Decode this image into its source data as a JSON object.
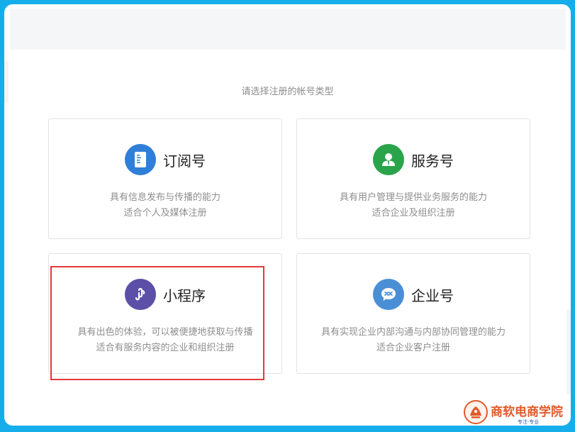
{
  "page": {
    "prompt": "请选择注册的帐号类型"
  },
  "cards": [
    {
      "title": "订阅号",
      "line1": "具有信息发布与传播的能力",
      "line2": "适合个人及媒体注册",
      "icon": "document-icon",
      "color": "#2f7fd8"
    },
    {
      "title": "服务号",
      "line1": "具有用户管理与提供业务服务的能力",
      "line2": "适合企业及组织注册",
      "icon": "user-icon",
      "color": "#2aa44a"
    },
    {
      "title": "小程序",
      "line1": "具有出色的体验，可以被便捷地获取与传播",
      "line2": "适合有服务内容的企业和组织注册",
      "icon": "mini-program-icon",
      "color": "#5b4fa8"
    },
    {
      "title": "企业号",
      "line1": "具有实现企业内部沟通与内部协同管理的能力",
      "line2": "适合企业客户注册",
      "icon": "enterprise-chat-icon",
      "color": "#4a8fd6"
    }
  ],
  "watermark": {
    "text": "商软电商学院",
    "sub": "专注·专业"
  },
  "colors": {
    "frame": "#15aeea",
    "highlight": "#e3393a"
  }
}
